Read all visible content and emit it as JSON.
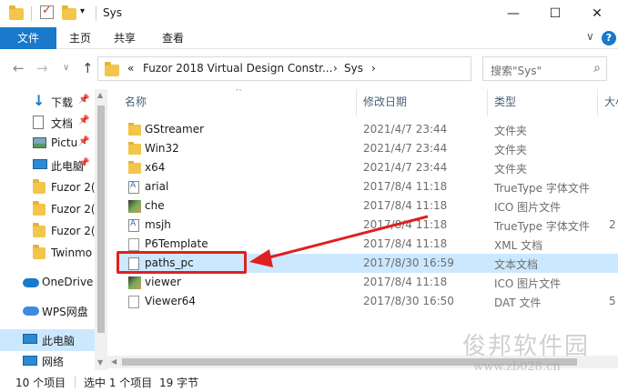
{
  "window": {
    "title": "Sys",
    "quick_access_dropdown": "▾",
    "minimize": "—",
    "maximize": "☐",
    "close": "✕"
  },
  "ribbon": {
    "tabs": [
      "文件",
      "主页",
      "共享",
      "查看"
    ],
    "expand": "∨",
    "help": "?"
  },
  "address": {
    "back": "←",
    "forward": "→",
    "recent": "∨",
    "up": "↑",
    "crumbs": [
      "«",
      "Fuzor 2018 Virtual Design Constr...",
      "›",
      "Sys",
      "›"
    ],
    "dropdown": "∨",
    "refresh": "↻"
  },
  "search": {
    "placeholder": "搜索\"Sys\"",
    "icon": "search-icon"
  },
  "nav": {
    "items": [
      {
        "label": "下载",
        "icon": "download-icon",
        "pinned": true
      },
      {
        "label": "文档",
        "icon": "document-icon",
        "pinned": true
      },
      {
        "label": "Pictu",
        "icon": "pictures-icon",
        "pinned": true
      },
      {
        "label": "此电脑",
        "icon": "pc-icon",
        "pinned": true
      },
      {
        "label": "Fuzor 2(",
        "icon": "folder-icon",
        "pinned": false
      },
      {
        "label": "Fuzor 2(",
        "icon": "folder-icon",
        "pinned": false
      },
      {
        "label": "Fuzor 2(",
        "icon": "folder-icon",
        "pinned": false
      },
      {
        "label": "Twinmo",
        "icon": "folder-icon",
        "pinned": false
      },
      {
        "label": "OneDrive",
        "icon": "onedrive-icon",
        "pinned": false
      },
      {
        "label": "WPS网盘",
        "icon": "wps-cloud-icon",
        "pinned": false
      },
      {
        "label": "此电脑",
        "icon": "pc-icon",
        "pinned": false
      },
      {
        "label": "网络",
        "icon": "network-icon",
        "pinned": false
      }
    ],
    "pin_glyph": "📌"
  },
  "columns": {
    "name": "名称",
    "modified": "修改日期",
    "type": "类型",
    "size": "大小",
    "sort_glyph": "^"
  },
  "files": [
    {
      "name": "GStreamer",
      "date": "2021/4/7 23:44",
      "type": "文件夹",
      "size": "",
      "icon": "folder"
    },
    {
      "name": "Win32",
      "date": "2021/4/7 23:44",
      "type": "文件夹",
      "size": "",
      "icon": "folder"
    },
    {
      "name": "x64",
      "date": "2021/4/7 23:44",
      "type": "文件夹",
      "size": "",
      "icon": "folder"
    },
    {
      "name": "arial",
      "date": "2017/8/4 11:18",
      "type": "TrueType 字体文件",
      "size": "",
      "icon": "font"
    },
    {
      "name": "che",
      "date": "2017/8/4 11:18",
      "type": "ICO 图片文件",
      "size": "",
      "icon": "image"
    },
    {
      "name": "msjh",
      "date": "2017/8/4 11:18",
      "type": "TrueType 字体文件",
      "size": "2",
      "icon": "font"
    },
    {
      "name": "P6Template",
      "date": "2017/8/4 11:18",
      "type": "XML 文档",
      "size": "",
      "icon": "blank"
    },
    {
      "name": "paths_pc",
      "date": "2017/8/30 16:59",
      "type": "文本文档",
      "size": "",
      "icon": "text"
    },
    {
      "name": "viewer",
      "date": "2017/8/4 11:18",
      "type": "ICO 图片文件",
      "size": "",
      "icon": "image"
    },
    {
      "name": "Viewer64",
      "date": "2017/8/30 16:50",
      "type": "DAT 文件",
      "size": "5",
      "icon": "blank"
    }
  ],
  "selected_file_index": 7,
  "status": {
    "count": "10 个项目",
    "selection": "选中 1 个项目",
    "size": "19 字节"
  },
  "watermark": {
    "title": "俊邦软件园",
    "url": "www.zb028.cn"
  },
  "colors": {
    "accent": "#1979ca",
    "selection": "#cce8ff",
    "annotation": "#e02020"
  }
}
